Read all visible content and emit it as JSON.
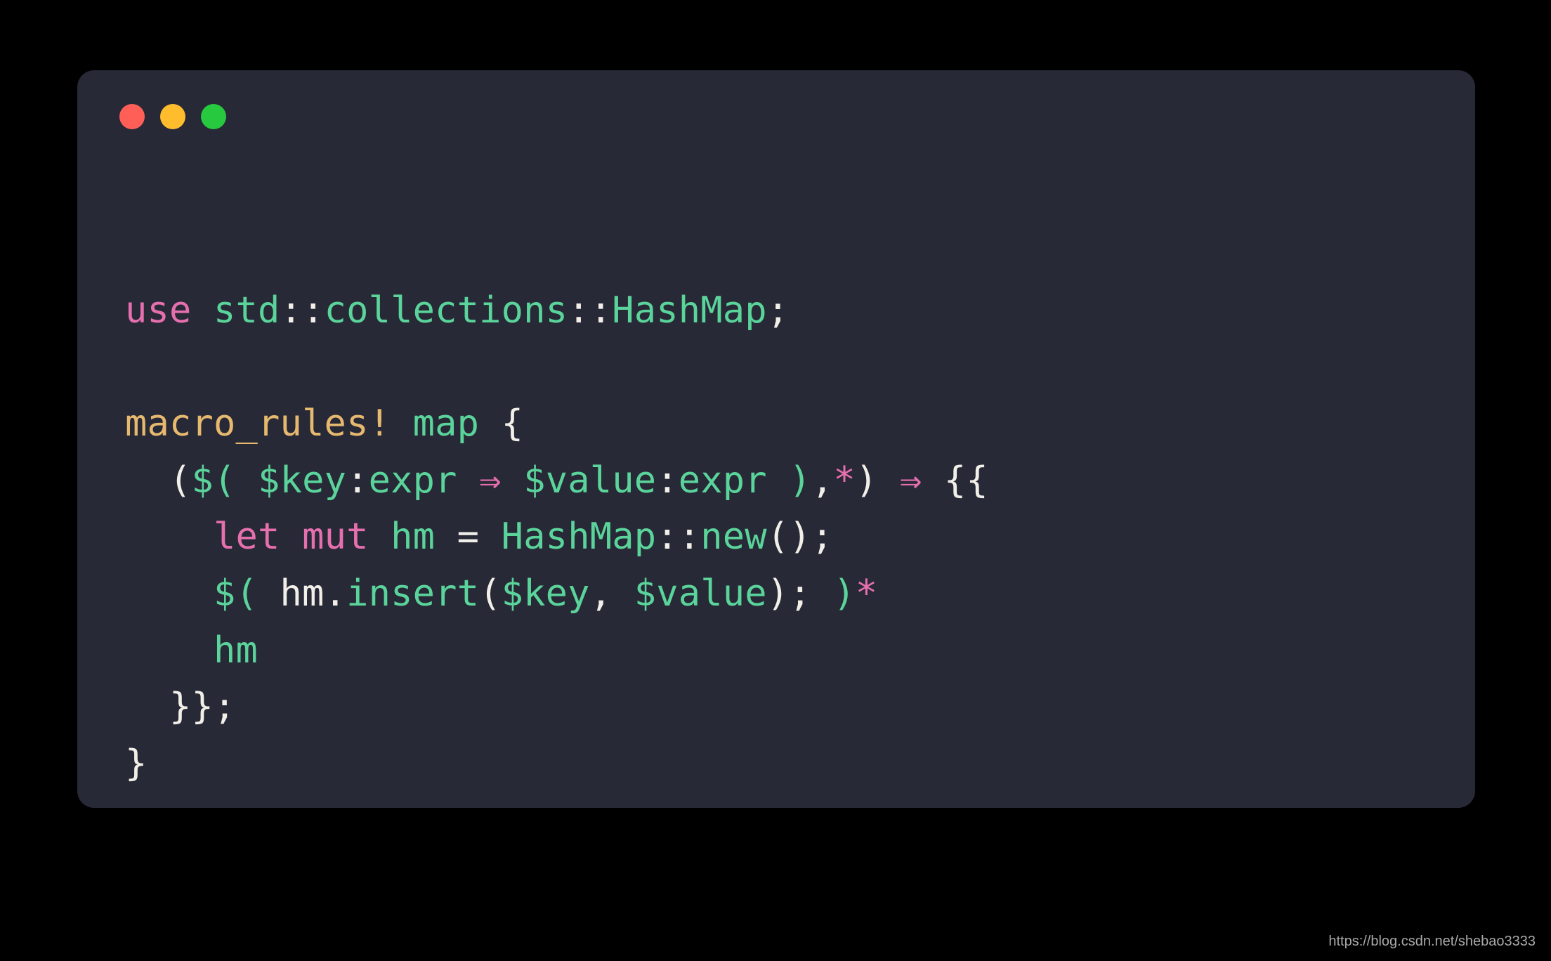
{
  "traffic_lights": [
    "red",
    "yellow",
    "green"
  ],
  "code": {
    "tokens": [
      {
        "t": "use",
        "c": "pink"
      },
      {
        "t": " ",
        "c": "default"
      },
      {
        "t": "std",
        "c": "green"
      },
      {
        "t": "::",
        "c": "default"
      },
      {
        "t": "collections",
        "c": "green"
      },
      {
        "t": "::",
        "c": "default"
      },
      {
        "t": "HashMap",
        "c": "green"
      },
      {
        "t": ";",
        "c": "default"
      },
      {
        "t": "\n",
        "c": "default"
      },
      {
        "t": "\n",
        "c": "default"
      },
      {
        "t": "macro_rules!",
        "c": "yellow"
      },
      {
        "t": " ",
        "c": "default"
      },
      {
        "t": "map",
        "c": "green"
      },
      {
        "t": " {",
        "c": "default"
      },
      {
        "t": "\n",
        "c": "default"
      },
      {
        "t": "  ",
        "c": "default"
      },
      {
        "t": "(",
        "c": "default"
      },
      {
        "t": "$(",
        "c": "green"
      },
      {
        "t": " ",
        "c": "default"
      },
      {
        "t": "$key",
        "c": "green"
      },
      {
        "t": ":",
        "c": "default"
      },
      {
        "t": "expr",
        "c": "green"
      },
      {
        "t": " ",
        "c": "default"
      },
      {
        "t": "⇒",
        "c": "pink"
      },
      {
        "t": " ",
        "c": "default"
      },
      {
        "t": "$value",
        "c": "green"
      },
      {
        "t": ":",
        "c": "default"
      },
      {
        "t": "expr",
        "c": "green"
      },
      {
        "t": " ",
        "c": "default"
      },
      {
        "t": ")",
        "c": "green"
      },
      {
        "t": ",",
        "c": "default"
      },
      {
        "t": "*",
        "c": "pink"
      },
      {
        "t": ") ",
        "c": "default"
      },
      {
        "t": "⇒",
        "c": "pink"
      },
      {
        "t": " {{",
        "c": "default"
      },
      {
        "t": "\n",
        "c": "default"
      },
      {
        "t": "    ",
        "c": "default"
      },
      {
        "t": "let",
        "c": "pink"
      },
      {
        "t": " ",
        "c": "default"
      },
      {
        "t": "mut",
        "c": "pink"
      },
      {
        "t": " ",
        "c": "default"
      },
      {
        "t": "hm",
        "c": "green"
      },
      {
        "t": " = ",
        "c": "default"
      },
      {
        "t": "HashMap",
        "c": "green"
      },
      {
        "t": "::",
        "c": "default"
      },
      {
        "t": "new",
        "c": "green"
      },
      {
        "t": "();",
        "c": "default"
      },
      {
        "t": "\n",
        "c": "default"
      },
      {
        "t": "    ",
        "c": "default"
      },
      {
        "t": "$(",
        "c": "green"
      },
      {
        "t": " hm.",
        "c": "default"
      },
      {
        "t": "insert",
        "c": "green"
      },
      {
        "t": "(",
        "c": "default"
      },
      {
        "t": "$key",
        "c": "green"
      },
      {
        "t": ", ",
        "c": "default"
      },
      {
        "t": "$value",
        "c": "green"
      },
      {
        "t": "); ",
        "c": "default"
      },
      {
        "t": ")",
        "c": "green"
      },
      {
        "t": "*",
        "c": "pink"
      },
      {
        "t": "\n",
        "c": "default"
      },
      {
        "t": "    ",
        "c": "default"
      },
      {
        "t": "hm",
        "c": "green"
      },
      {
        "t": "\n",
        "c": "default"
      },
      {
        "t": "  }};",
        "c": "default"
      },
      {
        "t": "\n",
        "c": "default"
      },
      {
        "t": "}",
        "c": "default"
      }
    ]
  },
  "watermark": "https://blog.csdn.net/shebao3333"
}
